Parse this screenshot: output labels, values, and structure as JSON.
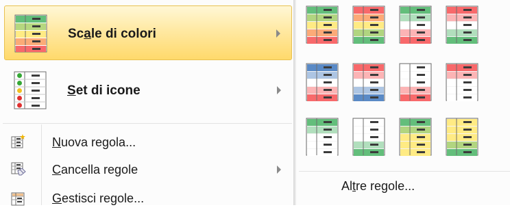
{
  "menu": {
    "items": [
      {
        "label_pre": "Sc",
        "label_ul": "a",
        "label_post": "le di colori",
        "icon": "color-scales-icon",
        "has_submenu": true,
        "selected": true
      },
      {
        "label_pre": "",
        "label_ul": "S",
        "label_post": "et di icone",
        "icon": "icon-sets-icon",
        "has_submenu": true,
        "selected": false
      }
    ],
    "commands": [
      {
        "label_pre": "",
        "label_ul": "N",
        "label_post": "uova regola...",
        "icon": "new-rule-icon",
        "has_submenu": false
      },
      {
        "label_pre": "",
        "label_ul": "C",
        "label_post": "ancella regole",
        "icon": "clear-rules-icon",
        "has_submenu": true
      },
      {
        "label_pre": "",
        "label_ul": "G",
        "label_post": "estisci regole...",
        "icon": "manage-rules-icon",
        "has_submenu": false
      }
    ]
  },
  "submenu": {
    "more_rules": {
      "label_pre": "Al",
      "label_ul": "t",
      "label_post": "re regole..."
    },
    "scales": [
      [
        "#63be7b",
        "#ffeb84",
        "#f8696b"
      ],
      [
        "#f8696b",
        "#ffeb84",
        "#63be7b"
      ],
      [
        "#63be7b",
        "#ffffff",
        "#f8696b"
      ],
      [
        "#f8696b",
        "#ffffff",
        "#63be7b"
      ],
      [
        "#5a8ac6",
        "#ffffff",
        "#f8696b"
      ],
      [
        "#f8696b",
        "#ffffff",
        "#5a8ac6"
      ],
      [
        "#ffffff",
        "#ffffff",
        "#f8696b"
      ],
      [
        "#f8696b",
        "#ffffff",
        "#ffffff"
      ],
      [
        "#63be7b",
        "#ffffff",
        "#ffffff"
      ],
      [
        "#ffffff",
        "#ffffff",
        "#63be7b"
      ],
      [
        "#63be7b",
        "#ffeb84",
        "#ffeb84"
      ],
      [
        "#ffeb84",
        "#ffeb84",
        "#63be7b"
      ]
    ]
  }
}
